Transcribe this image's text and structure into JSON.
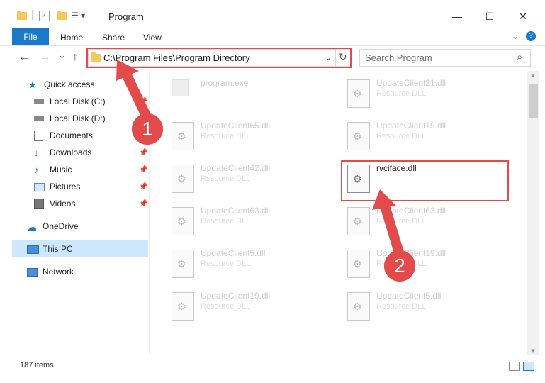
{
  "window": {
    "title": "Program",
    "controls": {
      "minimize": "—",
      "maximize": "☐",
      "close": "✕"
    }
  },
  "ribbon": {
    "tabs": [
      "File",
      "Home",
      "Share",
      "View"
    ],
    "expand_icon": "chevron-down-icon",
    "help_icon": "?"
  },
  "nav": {
    "back": "←",
    "forward": "→",
    "recent": "⌄",
    "up": "↑",
    "address": "C:\\Program Files\\Program Directory",
    "refresh": "↻",
    "dropdown": "⌄",
    "search_placeholder": "Search Program",
    "search_icon": "⌕"
  },
  "sidebar": {
    "items": [
      {
        "label": "Quick access",
        "icon": "star-icon"
      },
      {
        "label": "Local Disk (C:)",
        "icon": "drive-icon"
      },
      {
        "label": "Local Disk (D:)",
        "icon": "drive-icon"
      },
      {
        "label": "Documents",
        "icon": "documents-icon"
      },
      {
        "label": "Downloads",
        "icon": "download-icon"
      },
      {
        "label": "Music",
        "icon": "music-icon"
      },
      {
        "label": "Pictures",
        "icon": "pictures-icon"
      },
      {
        "label": "Videos",
        "icon": "videos-icon"
      },
      {
        "label": "OneDrive",
        "icon": "cloud-icon"
      },
      {
        "label": "This PC",
        "icon": "computer-icon"
      },
      {
        "label": "Network",
        "icon": "network-icon"
      }
    ]
  },
  "files": {
    "left": [
      {
        "name": "program.exe",
        "type": ""
      },
      {
        "name": "UpdateClient65.dll",
        "type": "Resource DLL"
      },
      {
        "name": "UpdateClient42.dll",
        "type": "Resource DLL"
      },
      {
        "name": "UpdateClient63.dll",
        "type": "Resource DLL"
      },
      {
        "name": "UpdateClient5.dll",
        "type": "Resource DLL"
      },
      {
        "name": "UpdateClient19.dll",
        "type": "Resource DLL"
      }
    ],
    "right": [
      {
        "name": "UpdateClient21.dll",
        "type": "Resource DLL"
      },
      {
        "name": "UpdateClient19.dll",
        "type": "Resource DLL"
      },
      {
        "name": "rvciface.dll",
        "type": ""
      },
      {
        "name": "UpdateClient63.dll",
        "type": "Resource DLL"
      },
      {
        "name": "UpdateClient19.dll",
        "type": "Resource DLL"
      },
      {
        "name": "UpdateClient5.dll",
        "type": "Resource DLL"
      }
    ]
  },
  "status": {
    "count": "187 items"
  },
  "annotations": {
    "step1": "1",
    "step2": "2"
  },
  "colors": {
    "accent": "#1979ca",
    "annotation": "#e34a4a",
    "selection": "#cce8ff"
  }
}
